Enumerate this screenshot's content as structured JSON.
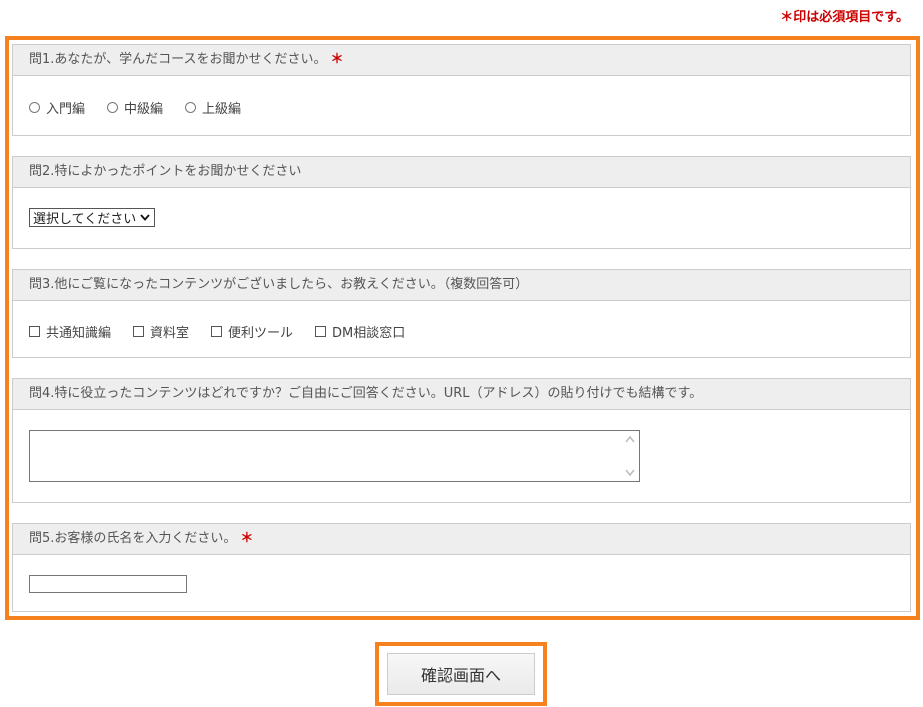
{
  "required_note": "＊印は必須項目です。",
  "required_star": "＊",
  "q1": {
    "title": "問1.あなたが、学んだコースをお聞かせください。",
    "options": [
      "入門編",
      "中級編",
      "上級編"
    ]
  },
  "q2": {
    "title": "問2.特によかったポイントをお聞かせください",
    "select_value": "選択してください"
  },
  "q3": {
    "title": "問3.他にご覧になったコンテンツがございましたら、お教えください。（複数回答可）",
    "options": [
      "共通知識編",
      "資料室",
      "便利ツール",
      "DM相談窓口"
    ]
  },
  "q4": {
    "title": "問4.特に役立ったコンテンツはどれですか？ご自由にご回答ください。URL（アドレス）の貼り付けでも結構です。",
    "value": ""
  },
  "q5": {
    "title": "問5.お客様の氏名を入力ください。",
    "value": ""
  },
  "submit_label": "確認画面へ",
  "colors": {
    "accent": "#f5821f",
    "required": "#cc0000",
    "header_bg": "#eeeeee"
  }
}
